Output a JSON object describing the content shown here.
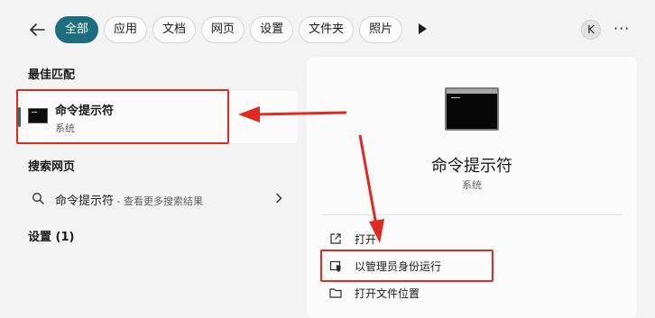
{
  "filters": {
    "tabs": [
      {
        "label": "全部",
        "active": true
      },
      {
        "label": "应用"
      },
      {
        "label": "文档"
      },
      {
        "label": "网页"
      },
      {
        "label": "设置"
      },
      {
        "label": "文件夹"
      },
      {
        "label": "照片"
      }
    ],
    "avatar_letter": "K",
    "more_label": "···"
  },
  "best_match": {
    "heading": "最佳匹配",
    "title": "命令提示符",
    "subtitle": "系统"
  },
  "web_search": {
    "heading": "搜索网页",
    "query": "命令提示符",
    "suffix": " - 查看更多搜索结果"
  },
  "settings": {
    "heading": "设置 (1)"
  },
  "details": {
    "title": "命令提示符",
    "subtitle": "系统",
    "actions": [
      {
        "label": "打开",
        "icon": "open-external-icon"
      },
      {
        "label": "以管理员身份运行",
        "icon": "shield-icon"
      },
      {
        "label": "打开文件位置",
        "icon": "folder-icon"
      }
    ]
  },
  "colors": {
    "accent": "#1c6e7e",
    "annotation": "#e02a20",
    "background": "#f3f3f3",
    "panel": "#fbfbfb"
  }
}
